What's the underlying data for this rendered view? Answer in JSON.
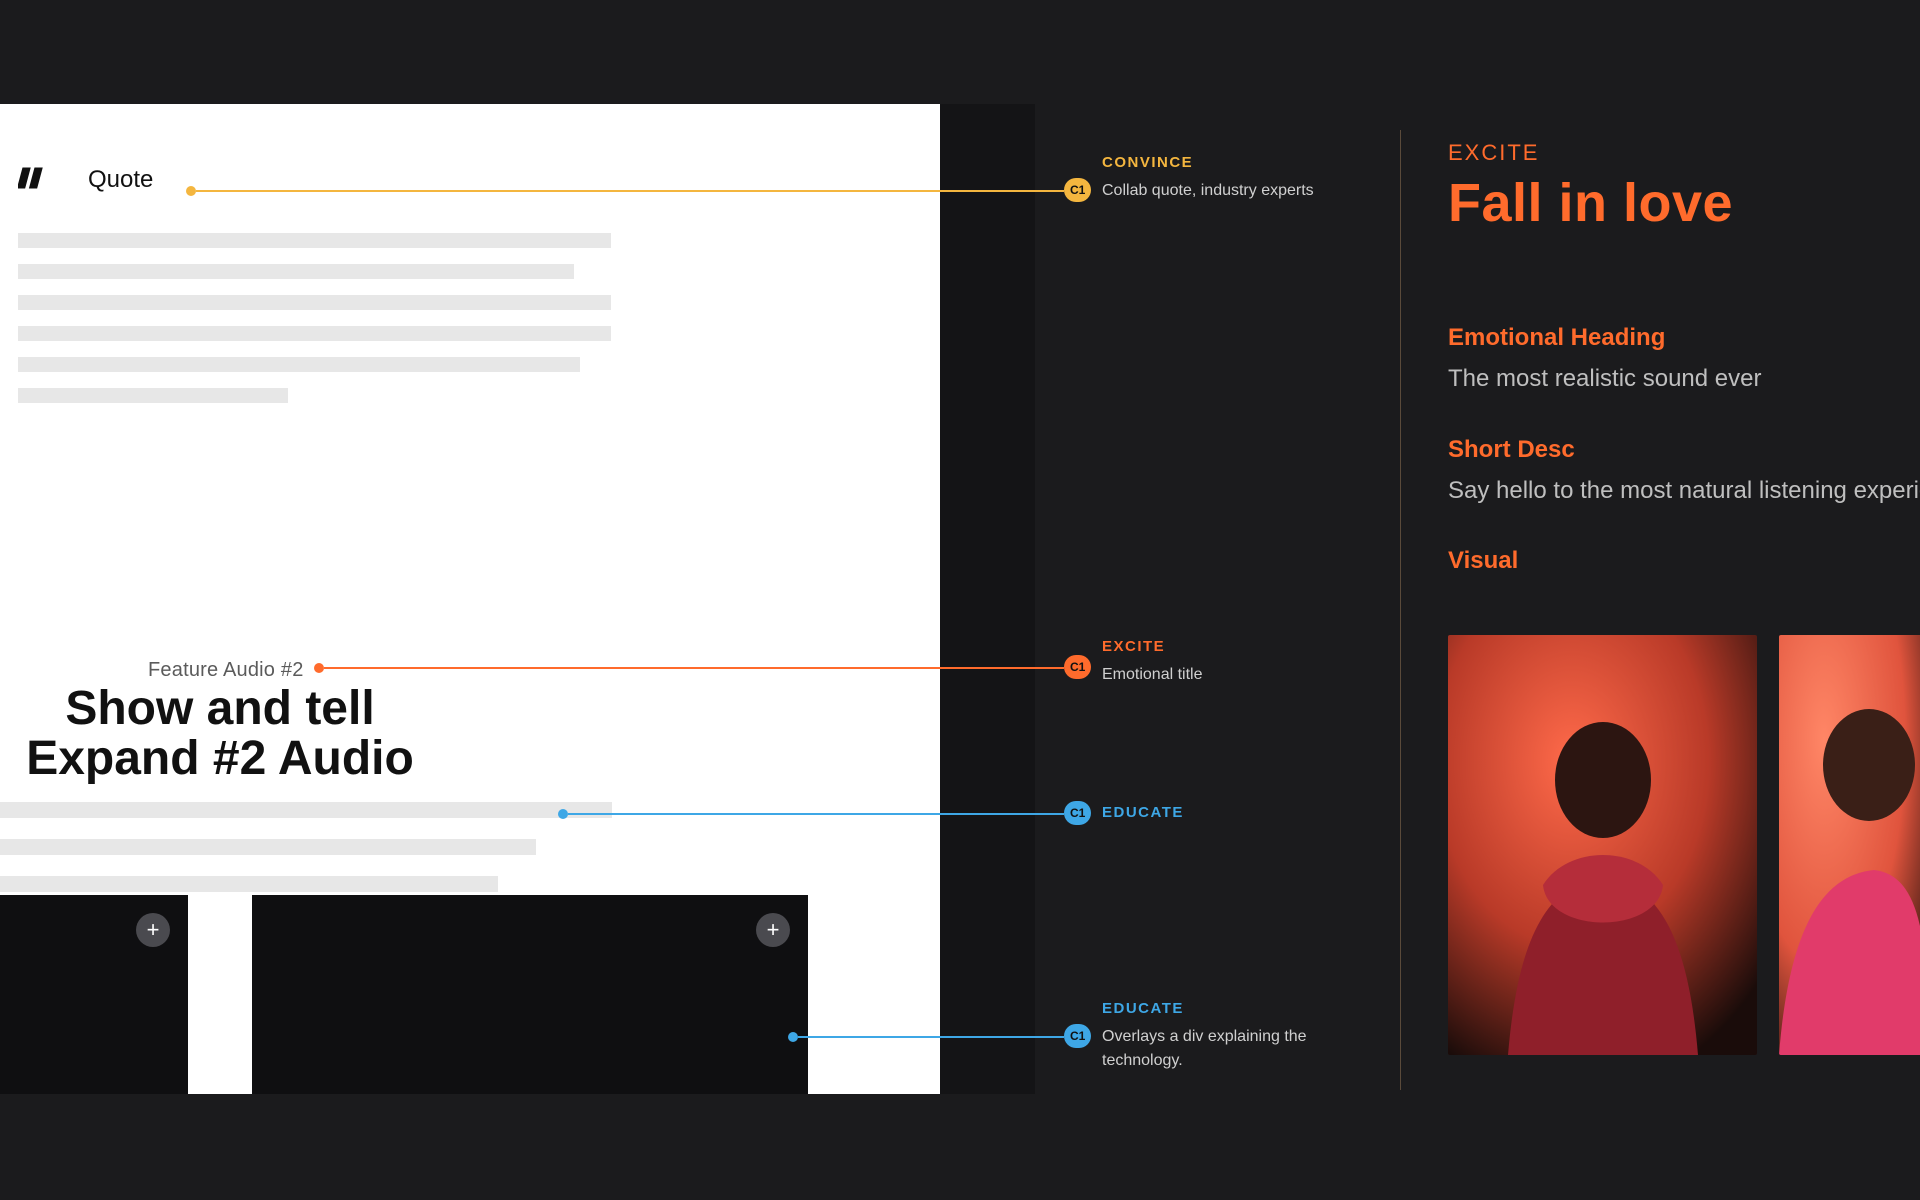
{
  "colors": {
    "orange": "#ff6b2c",
    "amber": "#f4b63f",
    "blue": "#3ea7e6"
  },
  "wireframe": {
    "quote_label": "Quote",
    "feature_eyebrow": "Feature Audio #2",
    "feature_heading": "Show and tell\nExpand #2 Audio"
  },
  "annotations": {
    "quote": {
      "badge": "C1",
      "tag": "CONVINCE",
      "desc": "Collab quote, industry experts"
    },
    "excite": {
      "badge": "C1",
      "tag": "EXCITE",
      "desc": "Emotional title"
    },
    "educate1": {
      "badge": "C1",
      "tag": "EDUCATE",
      "desc": ""
    },
    "educate2": {
      "badge": "C1",
      "tag": "EDUCATE",
      "desc": "Overlays a div explaining the technology."
    }
  },
  "detail": {
    "eyebrow": "EXCITE",
    "title": "Fall in love",
    "blocks": {
      "emotional_heading": {
        "label": "Emotional Heading",
        "value": "The most realistic sound ever"
      },
      "short_desc": {
        "label": "Short Desc",
        "value": "Say hello to the most natural listening experienc"
      },
      "visual": {
        "label": "Visual"
      }
    }
  }
}
